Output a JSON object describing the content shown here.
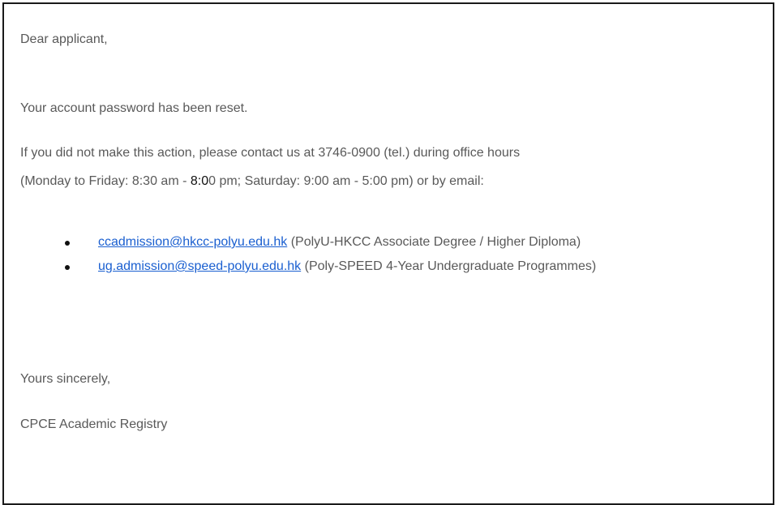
{
  "email": {
    "greeting": "Dear applicant,",
    "reset_notice": "Your account password has been reset.",
    "contact_line1": "If you did not make this action, please contact us at 3746-0900 (tel.) during office hours",
    "contact_line2_a": "(Monday to Friday: 8:30 am - ",
    "contact_line2_b": "8:0",
    "contact_line2_c": "0 pm; Saturday: 9:00 am - 5:00 pm) or by email:",
    "contacts": [
      {
        "address": "ccadmission@hkcc-polyu.edu.hk",
        "description": "(PolyU-HKCC Associate Degree / Higher Diploma)"
      },
      {
        "address": "ug.admission@speed-polyu.edu.hk",
        "description": "(Poly-SPEED 4-Year Undergraduate Programmes)"
      }
    ],
    "closing": "Yours sincerely,",
    "signature": "CPCE Academic Registry"
  }
}
